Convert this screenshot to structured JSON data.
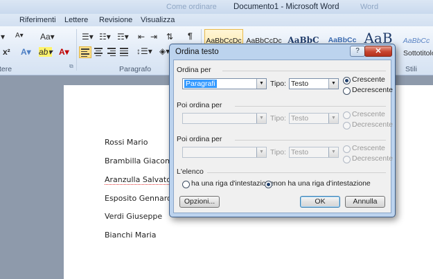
{
  "window": {
    "title": "Documento1  -  Microsoft Word",
    "faded_title_left": "Come ordinare",
    "faded_title_right": "Word"
  },
  "ribbon": {
    "tabs": [
      "Riferimenti",
      "Lettere",
      "Revisione",
      "Visualizza"
    ],
    "groups": {
      "left_fragment": "tere",
      "paragraph": "Paragrafo",
      "styles": "Stili"
    },
    "font_buttons": {
      "size_case": "Aa▾",
      "superscript": "x²",
      "text_effects": "A▾",
      "highlight": "ab▾",
      "font_color": "A▾"
    },
    "paragraph_buttons": {
      "show_marks": "¶"
    },
    "styles": [
      {
        "preview": "AaBbCcDc",
        "selected": true
      },
      {
        "preview": "AaBbCcDc",
        "selected": false
      },
      {
        "preview": "AaBbC",
        "selected": false
      },
      {
        "preview": "AaBbCc",
        "selected": false
      },
      {
        "preview": "AaB",
        "selected": false
      },
      {
        "preview": "AaBbCc",
        "selected": false
      }
    ],
    "style_visible_name": "Sottotitolo"
  },
  "document": {
    "lines": [
      "Rossi Mario",
      "Brambilla Giacomo",
      "Aranzulla Salvatore",
      "Esposito Gennaro",
      "Verdi Giuseppe",
      "Bianchi Maria"
    ]
  },
  "dialog": {
    "title": "Ordina testo",
    "help_label": "?",
    "close_label": "✕",
    "sort_by": {
      "label": "Ordina per",
      "field_value": "Paragrafi",
      "type_label": "Tipo:",
      "type_value": "Testo",
      "ascending": "Crescente",
      "descending": "Decrescente",
      "selected": "ascending"
    },
    "then_by_1": {
      "label": "Poi ordina per",
      "field_value": "",
      "type_label": "Tipo:",
      "type_value": "Testo",
      "ascending": "Crescente",
      "descending": "Decrescente"
    },
    "then_by_2": {
      "label": "Poi ordina per",
      "field_value": "",
      "type_label": "Tipo:",
      "type_value": "Testo",
      "ascending": "Crescente",
      "descending": "Decrescente"
    },
    "list": {
      "label": "L'elenco",
      "has_header": "ha una riga d'intestazione",
      "no_header": "non ha una riga d'intestazione",
      "selected": "no_header"
    },
    "buttons": {
      "options": "Opzioni...",
      "ok": "OK",
      "cancel": "Annulla"
    }
  },
  "colors": {
    "dialog_frame": "#bcd3ee",
    "selection": "#3399ff",
    "close_button": "#c6432e"
  }
}
